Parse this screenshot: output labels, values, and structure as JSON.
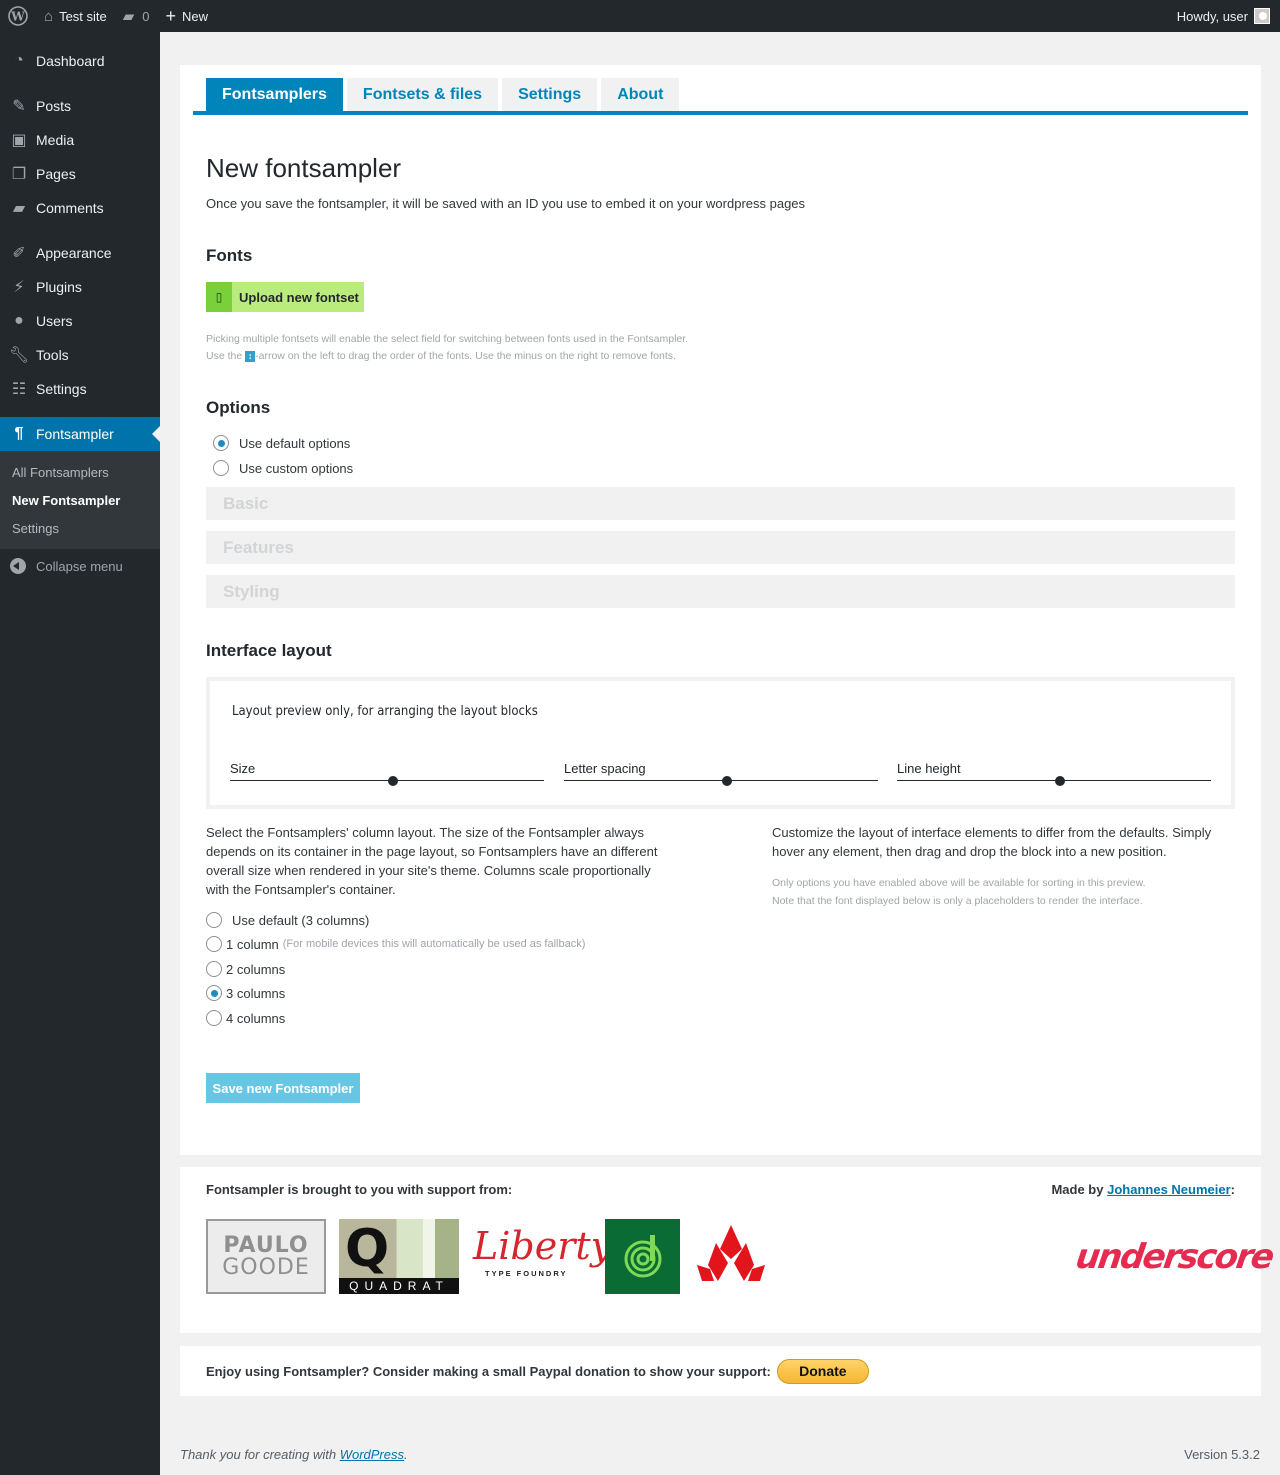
{
  "adminbar": {
    "site_name": "Test site",
    "comments_count": "0",
    "new_label": "New",
    "howdy": "Howdy, user"
  },
  "sidebar": {
    "items": [
      {
        "label": "Dashboard",
        "icon": "dashboard-icon"
      },
      {
        "label": "Posts",
        "icon": "pin-icon"
      },
      {
        "label": "Media",
        "icon": "media-icon"
      },
      {
        "label": "Pages",
        "icon": "pages-icon"
      },
      {
        "label": "Comments",
        "icon": "comment-icon"
      },
      {
        "label": "Appearance",
        "icon": "brush-icon"
      },
      {
        "label": "Plugins",
        "icon": "plug-icon"
      },
      {
        "label": "Users",
        "icon": "user-icon"
      },
      {
        "label": "Tools",
        "icon": "wrench-icon"
      },
      {
        "label": "Settings",
        "icon": "sliders-icon"
      },
      {
        "label": "Fontsampler",
        "icon": "pilcrow-icon"
      }
    ],
    "submenu": [
      "All Fontsamplers",
      "New Fontsampler",
      "Settings"
    ],
    "collapse_label": "Collapse menu"
  },
  "tabs": [
    "Fontsamplers",
    "Fontsets & files",
    "Settings",
    "About"
  ],
  "page": {
    "title": "New fontsampler",
    "description": "Once you save the fontsampler, it will be saved with an ID you use to embed it on your wordpress pages",
    "fonts_heading": "Fonts",
    "upload_label": "Upload new fontset",
    "fonts_hint_1": "Picking multiple fontsets will enable the select field for switching between fonts used in the Fontsampler.",
    "fonts_hint_2a": "Use the",
    "fonts_hint_2b": "-arrow on the left to drag the order of the fonts. Use the minus on the right to remove fonts.",
    "options_heading": "Options",
    "option_default": "Use default options",
    "option_custom": "Use custom options",
    "accordions": [
      "Basic",
      "Features",
      "Styling"
    ],
    "layout_heading": "Interface layout",
    "preview_note": "Layout preview only, for arranging the layout blocks",
    "sliders": [
      {
        "label": "Size",
        "value": 0.52
      },
      {
        "label": "Letter spacing",
        "value": 0.52
      },
      {
        "label": "Line height",
        "value": 0.52
      }
    ],
    "columns_text": "Select the Fontsamplers' column layout. The size of the Fontsampler always depends on its container in the page layout, so Fontsamplers have an different overall size when rendered in your site's theme. Columns scale proportionally with the Fontsampler's container.",
    "column_options": [
      {
        "label": "Use default (3 columns)",
        "hint": ""
      },
      {
        "label": "1 column",
        "hint": "(For mobile devices this will automatically be used as fallback)"
      },
      {
        "label": "2 columns",
        "hint": ""
      },
      {
        "label": "3 columns",
        "hint": ""
      },
      {
        "label": "4 columns",
        "hint": ""
      }
    ],
    "customize_text": "Customize the layout of interface elements to differ from the defaults. Simply hover any element, then drag and drop the block into a new position.",
    "customize_hint_1": "Only options you have enabled above will be available for sorting in this preview.",
    "customize_hint_2": "Note that the font displayed below is only a placeholders to render the interface.",
    "save_label": "Save new Fontsampler"
  },
  "support": {
    "title": "Fontsampler is brought to you with support from:",
    "made_by": "Made by",
    "author": "Johannes Neumeier",
    "colon": ":",
    "logos": {
      "paulo_1": "PAULO",
      "paulo_2": "GOODE",
      "quadrat_q": "Q",
      "quadrat_name": "QUADRAT",
      "liberty": "Liberty",
      "liberty_sub": "TYPE FOUNDRY",
      "underscore": "underscore"
    }
  },
  "donate": {
    "text": "Enjoy using Fontsampler? Consider making a small Paypal donation to show your support:",
    "button": "Donate"
  },
  "footer": {
    "thanks_prefix": "Thank you for creating with",
    "wp_link": "WordPress",
    "thanks_suffix": ".",
    "version": "Version 5.3.2"
  }
}
